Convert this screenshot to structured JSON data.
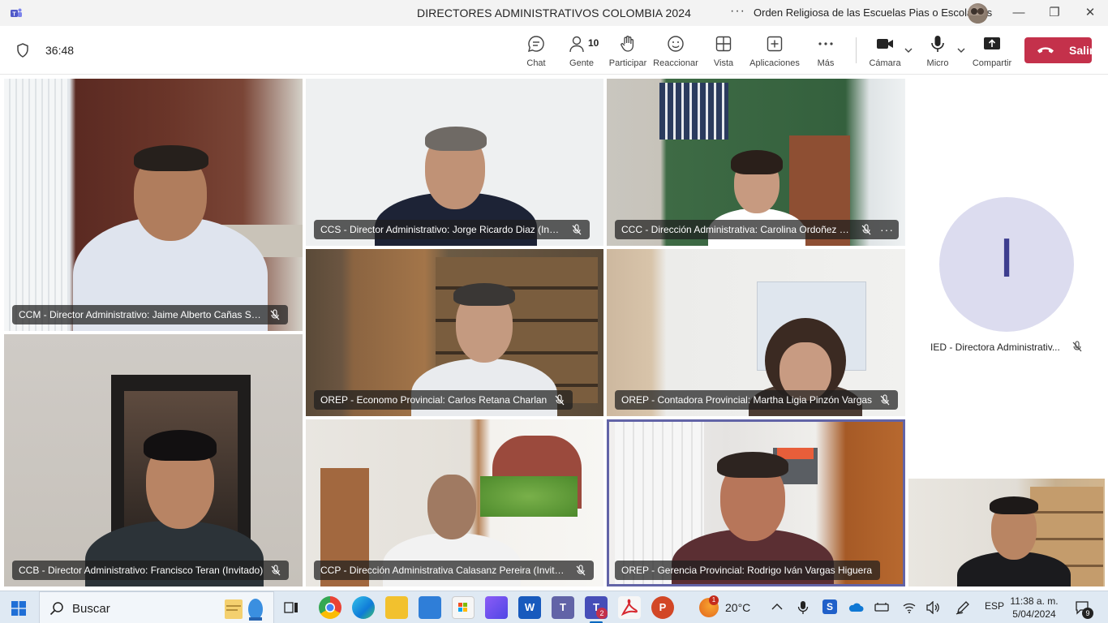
{
  "window": {
    "title": "DIRECTORES ADMINISTRATIVOS COLOMBIA 2024",
    "organization": "Orden Religiosa de las Escuelas Pias o Escolapios",
    "more": "···",
    "minimize": "—",
    "restore": "❐",
    "close": "✕"
  },
  "toolbar": {
    "timer": "36:48",
    "items": [
      {
        "label": "Chat",
        "icon": "chat-icon"
      },
      {
        "label": "Gente",
        "icon": "people-icon",
        "count": "10"
      },
      {
        "label": "Participar",
        "icon": "raise-hand-icon"
      },
      {
        "label": "Reaccionar",
        "icon": "emoji-icon"
      },
      {
        "label": "Vista",
        "icon": "grid-view-icon"
      },
      {
        "label": "Aplicaciones",
        "icon": "add-apps-icon"
      },
      {
        "label": "Más",
        "icon": "more-icon"
      },
      {
        "label": "Cámara",
        "icon": "camera-icon"
      },
      {
        "label": "Micro",
        "icon": "microphone-icon"
      },
      {
        "label": "Compartir",
        "icon": "share-icon"
      }
    ],
    "more_glyph": "···",
    "leave_label": "Salir",
    "leave_color": "#c4314b"
  },
  "participants": [
    {
      "name": "CCM - Director Administrativo: Jaime Alberto Cañas Sán..."
    },
    {
      "name": "CCS - Director Administrativo: Jorge Ricardo Diaz (Invita..."
    },
    {
      "name": "CCC - Dirección Administrativa: Carolina Ordoñez Cl..."
    },
    {
      "name": "OREP - Economo Provincial: Carlos Retana Charlan"
    },
    {
      "name": "OREP - Contadora Provincial: Martha Ligia Pinzón Vargas"
    },
    {
      "name": "CCB - Director Administrativo: Francisco Teran (Invitado)"
    },
    {
      "name": "CCP - Dirección Administrativa Calasanz Pereira (Invitado)"
    },
    {
      "name": "OREP - Gerencia Provincial: Rodrigo Iván Vargas Higuera"
    },
    {
      "name": "IED - Directora Administrativ...",
      "initial": "I"
    }
  ],
  "tile_more": "···",
  "taskbar": {
    "search_placeholder": "Buscar",
    "weather": "20°C",
    "weather_alert": "1",
    "language": "ESP",
    "time": "11:38 a. m.",
    "date": "5/04/2024",
    "notifications": "9",
    "teams_badge": "2"
  },
  "colors": {
    "accent": "#6264a7",
    "leave": "#c4314b",
    "avatar_bg": "#dcdcef"
  }
}
